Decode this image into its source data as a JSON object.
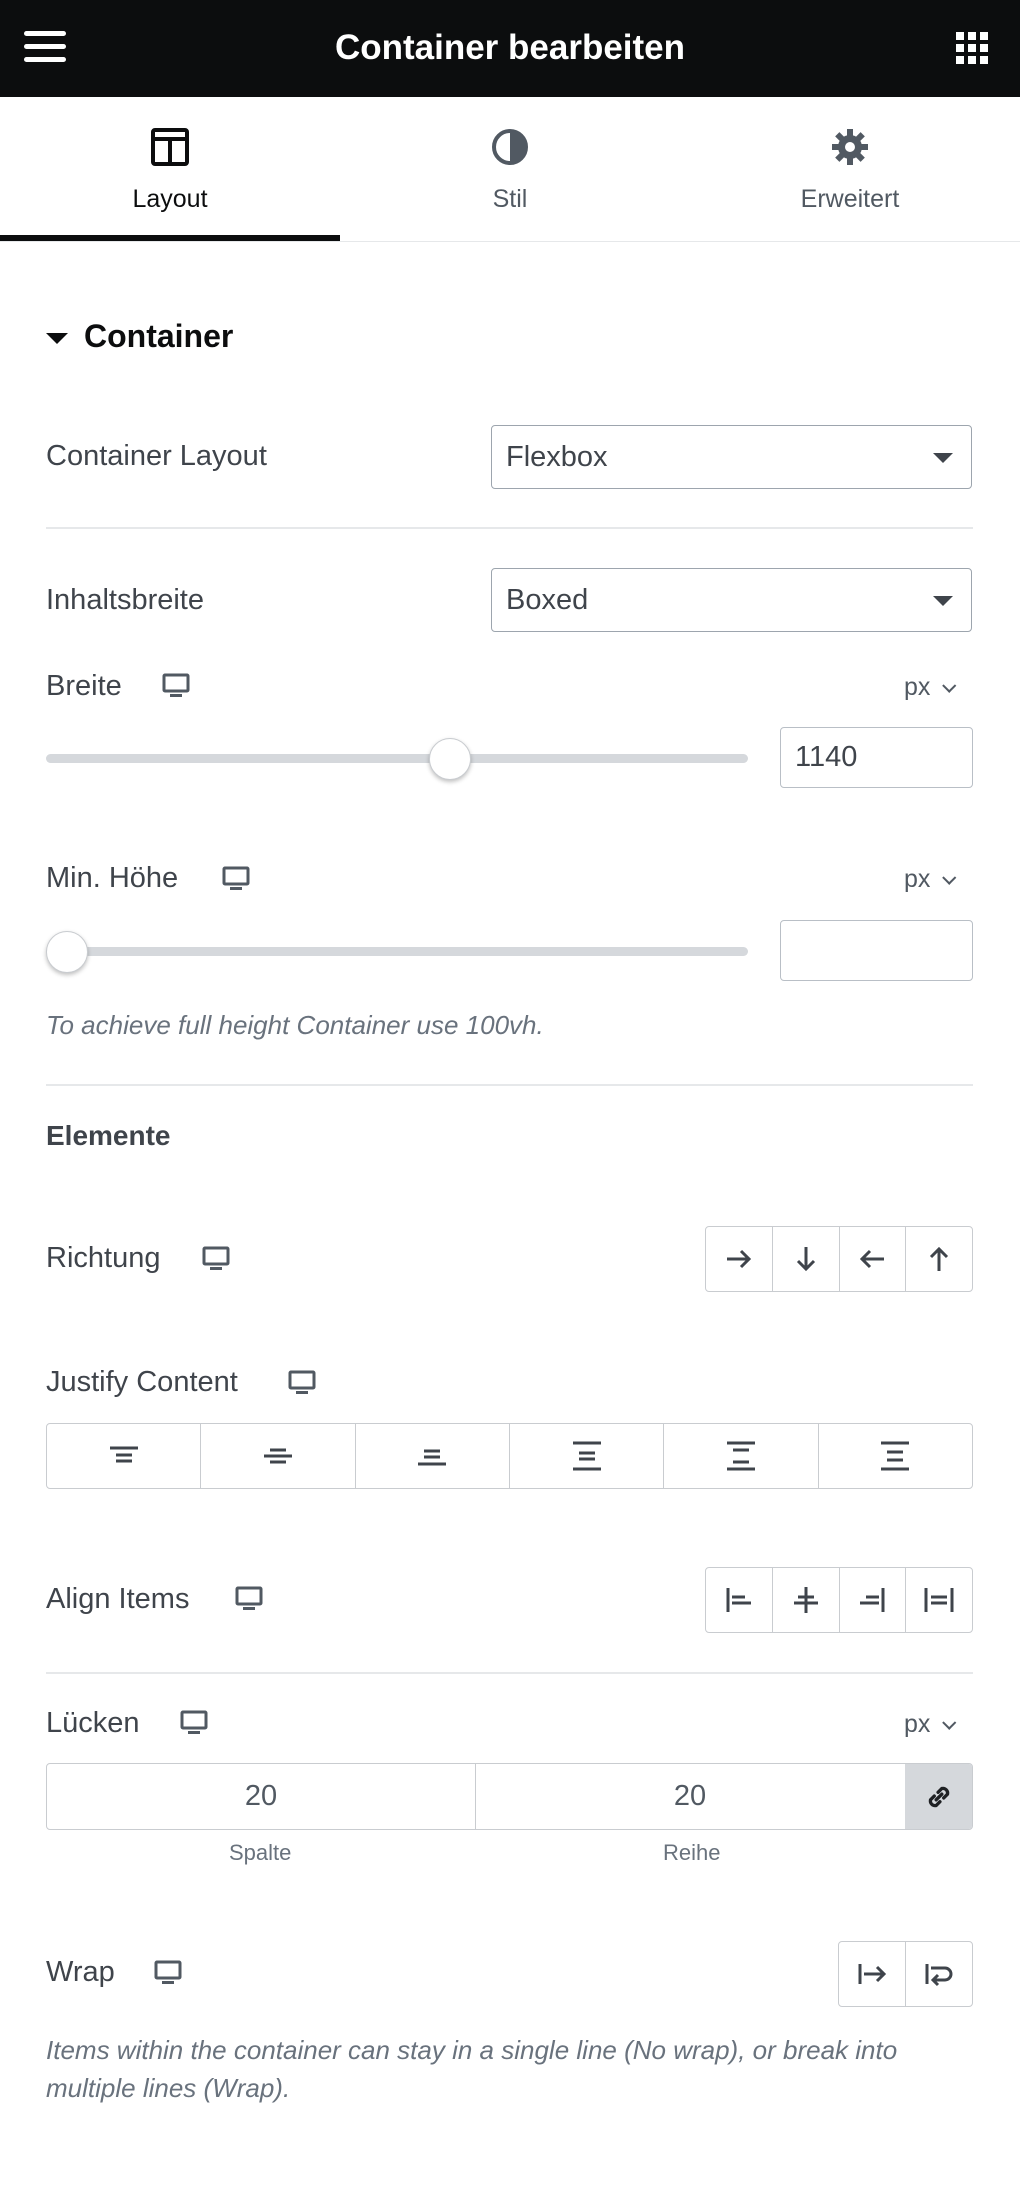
{
  "header": {
    "title": "Container bearbeiten",
    "menu_icon": "hamburger-menu-icon",
    "apps_icon": "grid-apps-icon"
  },
  "tabs": [
    {
      "label": "Layout",
      "icon": "layout-columns-icon",
      "active": true
    },
    {
      "label": "Stil",
      "icon": "contrast-half-circle-icon",
      "active": false
    },
    {
      "label": "Erweitert",
      "icon": "gear-icon",
      "active": false
    }
  ],
  "section": {
    "title": "Container",
    "expanded": true
  },
  "container_layout": {
    "label": "Container Layout",
    "value": "Flexbox"
  },
  "content_width": {
    "label": "Inhaltsbreite",
    "value": "Boxed"
  },
  "width": {
    "label": "Breite",
    "unit": "px",
    "value": "1140",
    "slider_fraction": 0.58
  },
  "min_height": {
    "label": "Min. Höhe",
    "unit": "px",
    "value": "",
    "slider_fraction": 0.0,
    "hint": "To achieve full height Container use 100vh."
  },
  "elements": {
    "heading": "Elemente"
  },
  "direction": {
    "label": "Richtung",
    "options": [
      "row-arrow-right-icon",
      "column-arrow-down-icon",
      "row-reverse-arrow-left-icon",
      "column-reverse-arrow-up-icon"
    ]
  },
  "justify_content": {
    "label": "Justify Content",
    "options": [
      "justify-start-icon",
      "justify-center-icon",
      "justify-end-icon",
      "justify-space-between-icon",
      "justify-space-around-icon",
      "justify-space-evenly-icon"
    ]
  },
  "align_items": {
    "label": "Align Items",
    "options": [
      "align-start-icon",
      "align-center-icon",
      "align-end-icon",
      "align-stretch-icon"
    ]
  },
  "gaps": {
    "label": "Lücken",
    "unit": "px",
    "column_value": "20",
    "row_value": "20",
    "column_label": "Spalte",
    "row_label": "Reihe",
    "link_icon": "link-icon"
  },
  "wrap": {
    "label": "Wrap",
    "options": [
      "no-wrap-icon",
      "wrap-icon"
    ],
    "hint": "Items within the container can stay in a single line (No wrap), or break into multiple lines (Wrap)."
  },
  "colors": {
    "header_bg": "#0c0d0e",
    "text": "#3f444b",
    "muted": "#69727d",
    "border": "#c9ccd0",
    "link_bg": "#d5d8dc"
  }
}
